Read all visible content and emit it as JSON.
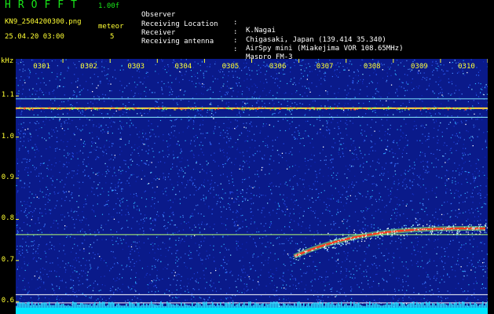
{
  "app": {
    "title": "HROFFT",
    "version": "1.00f",
    "filename": "KN9_2504200300.png",
    "datetime": "25.04.20 03:00",
    "meteor_label": "meteor",
    "meteor_count": "5"
  },
  "info": [
    {
      "key": "Observer",
      "value": "K.Nagai"
    },
    {
      "key": "Receiving Location",
      "value": "Chigasaki, Japan (139.414 35.340)"
    },
    {
      "key": "Receiver",
      "value": "AirSpy mini (Miakejima VOR 108.65MHz)"
    },
    {
      "key": "Receiving antenna",
      "value": "Maspro FM-3"
    }
  ],
  "colors": {
    "text_yellow": "#ffff33",
    "title_green": "#19e619",
    "background": "#000000",
    "plot_bg": "#0a1a8a",
    "noise_floor": "#00e5ff"
  },
  "chart_data": {
    "type": "heatmap",
    "title": "",
    "xlabel": "",
    "ylabel": "kHz",
    "x_ticks": [
      "0301",
      "0302",
      "0303",
      "0304",
      "0305",
      "0306",
      "0307",
      "0308",
      "0309",
      "0310"
    ],
    "y_ticks": [
      "1.1",
      "1.0",
      "0.9",
      "0.8",
      "0.7",
      "0.6"
    ],
    "ylim": [
      0.57,
      1.19
    ],
    "xlim_minutes": [
      0,
      10
    ],
    "carrier_lines_khz": [
      1.093,
      1.07,
      1.048,
      0.763,
      0.617,
      0.597
    ],
    "meteor_echo": {
      "start_minute": 5.9,
      "end_minute": 9.95,
      "start_khz": 0.71,
      "end_khz": 0.778
    },
    "grid": false
  }
}
